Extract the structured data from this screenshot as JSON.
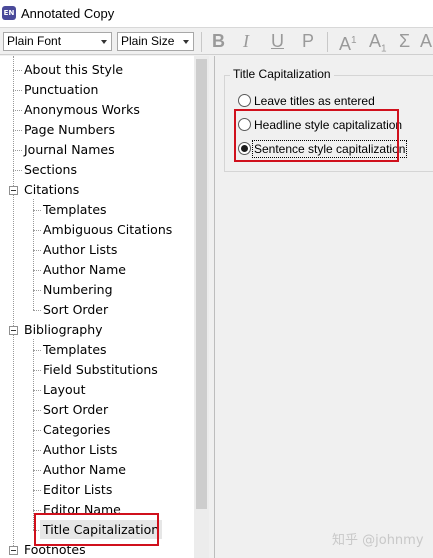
{
  "window": {
    "title": "Annotated Copy",
    "app_icon_text": "EN"
  },
  "toolbar": {
    "font_value": "Plain Font",
    "size_value": "Plain Size",
    "bold": "B",
    "italic": "I",
    "underline": "U",
    "plain": "P",
    "superscript_base": "A",
    "superscript_mark": "1",
    "subscript_base": "A",
    "subscript_mark": "1",
    "sigma": "Σ",
    "abc": "A"
  },
  "tree": {
    "items": [
      "About this Style",
      "Punctuation",
      "Anonymous Works",
      "Page Numbers",
      "Journal Names",
      "Sections",
      "Citations",
      "Templates",
      "Ambiguous Citations",
      "Author Lists",
      "Author Name",
      "Numbering",
      "Sort Order",
      "Bibliography",
      "Templates",
      "Field Substitutions",
      "Layout",
      "Sort Order",
      "Categories",
      "Author Lists",
      "Author Name",
      "Editor Lists",
      "Editor Name",
      "Title Capitalization",
      "Footnotes"
    ],
    "selected": "Title Capitalization"
  },
  "panel": {
    "group_title": "Title Capitalization",
    "options": [
      "Leave titles as entered",
      "Headline style capitalization",
      "Sentence style capitalization"
    ],
    "selected_option": "Sentence style capitalization"
  },
  "watermark": "知乎 @johnmy",
  "colors": {
    "highlight_box": "#d0101c",
    "app_icon": "#4a4a9a"
  }
}
